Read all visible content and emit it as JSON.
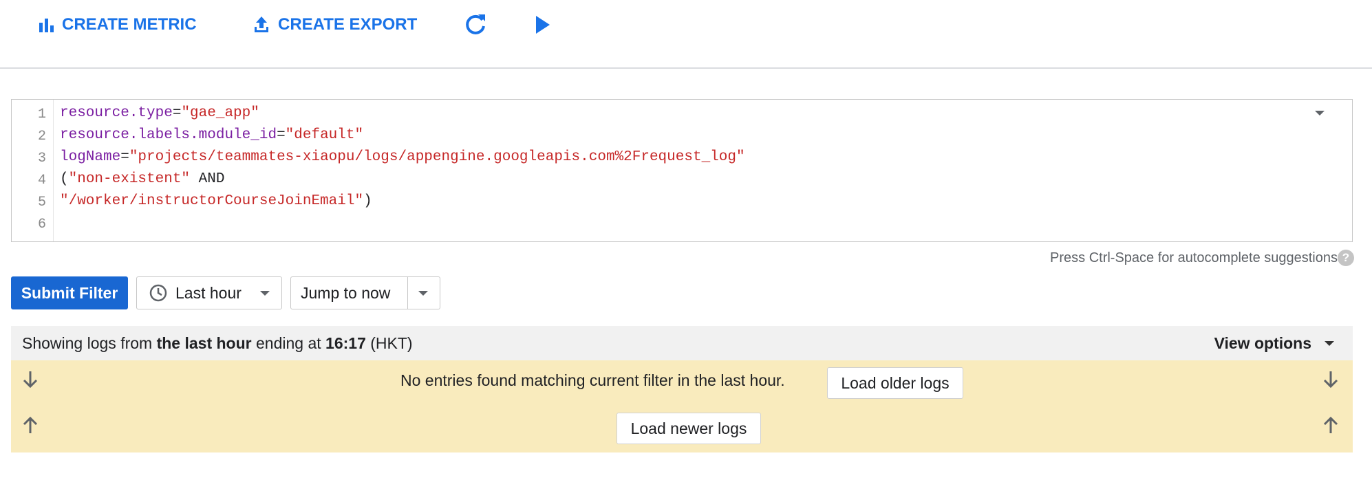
{
  "toolbar": {
    "create_metric_label": "CREATE METRIC",
    "create_export_label": "CREATE EXPORT",
    "refresh_icon": "refresh-icon",
    "play_icon": "play-icon"
  },
  "editor": {
    "line_numbers": [
      "1",
      "2",
      "3",
      "4",
      "5",
      "6"
    ],
    "lines": [
      {
        "key": "resource.type",
        "op": "=",
        "value": "\"gae_app\""
      },
      {
        "key": "resource.labels.module_id",
        "op": "=",
        "value": "\"default\""
      },
      {
        "key": "logName",
        "op": "=",
        "value": "\"projects/teammates-xiaopu/logs/appengine.googleapis.com%2Frequest_log\""
      },
      {
        "open": "(",
        "value": "\"non-existent\"",
        "rest": " AND"
      },
      {
        "value": "\"/worker/instructorCourseJoinEmail\"",
        "close": ")"
      }
    ],
    "hint": "Press Ctrl-Space for autocomplete suggestions"
  },
  "filter": {
    "submit_label": "Submit Filter",
    "range_label": "Last hour",
    "jump_label": "Jump to now"
  },
  "status": {
    "prefix": "Showing logs from ",
    "range_bold": "the last hour",
    "middle": " ending at ",
    "time_bold": "16:17",
    "tz": " (HKT)",
    "view_options_label": "View options"
  },
  "notice": {
    "message": "No entries found matching current filter in the last hour.",
    "load_older_label": "Load older logs",
    "load_newer_label": "Load newer logs"
  },
  "colors": {
    "accent": "#1a73e8",
    "submit_bg": "#1967d2",
    "notice_bg": "#f9ebbd",
    "code_key": "#7b1fa2",
    "code_string": "#c62828"
  }
}
